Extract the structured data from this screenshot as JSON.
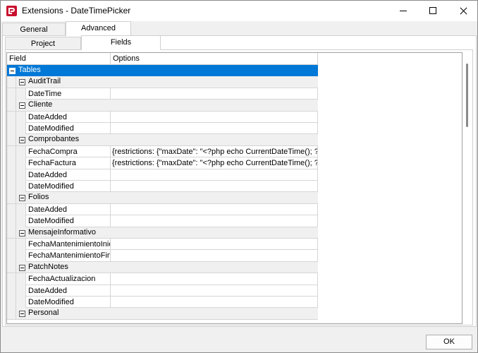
{
  "window": {
    "title": "Extensions - DateTimePicker"
  },
  "tabs_top": [
    {
      "label": "General"
    },
    {
      "label": "Advanced"
    }
  ],
  "tabs_sub": [
    {
      "label": "Project"
    },
    {
      "label": "Fields"
    }
  ],
  "grid": {
    "headers": {
      "field": "Field",
      "options": "Options"
    },
    "root": "Tables",
    "groups": [
      {
        "name": "AuditTrail",
        "fields": [
          {
            "name": "DateTime",
            "options": ""
          }
        ]
      },
      {
        "name": "Cliente",
        "fields": [
          {
            "name": "DateAdded",
            "options": ""
          },
          {
            "name": "DateModified",
            "options": ""
          }
        ]
      },
      {
        "name": "Comprobantes",
        "fields": [
          {
            "name": "FechaCompra",
            "options": "{restrictions: {\"maxDate\": \"<?php echo CurrentDateTime(); ?>\"}}"
          },
          {
            "name": "FechaFactura",
            "options": "{restrictions: {\"maxDate\": \"<?php echo CurrentDateTime(); ?>\"}}"
          },
          {
            "name": "DateAdded",
            "options": ""
          },
          {
            "name": "DateModified",
            "options": ""
          }
        ]
      },
      {
        "name": "Folios",
        "fields": [
          {
            "name": "DateAdded",
            "options": ""
          },
          {
            "name": "DateModified",
            "options": ""
          }
        ]
      },
      {
        "name": "MensajeInformativo",
        "fields": [
          {
            "name": "FechaMantenimientoInicio",
            "options": ""
          },
          {
            "name": "FechaMantenimientoFin",
            "options": ""
          }
        ]
      },
      {
        "name": "PatchNotes",
        "fields": [
          {
            "name": "FechaActualizacion",
            "options": ""
          },
          {
            "name": "DateAdded",
            "options": ""
          },
          {
            "name": "DateModified",
            "options": ""
          }
        ]
      },
      {
        "name": "Personal",
        "fields": []
      }
    ]
  },
  "footer": {
    "ok_label": "OK"
  },
  "colors": {
    "selection": "#0078d7",
    "group_bg": "#f0f0f0"
  }
}
